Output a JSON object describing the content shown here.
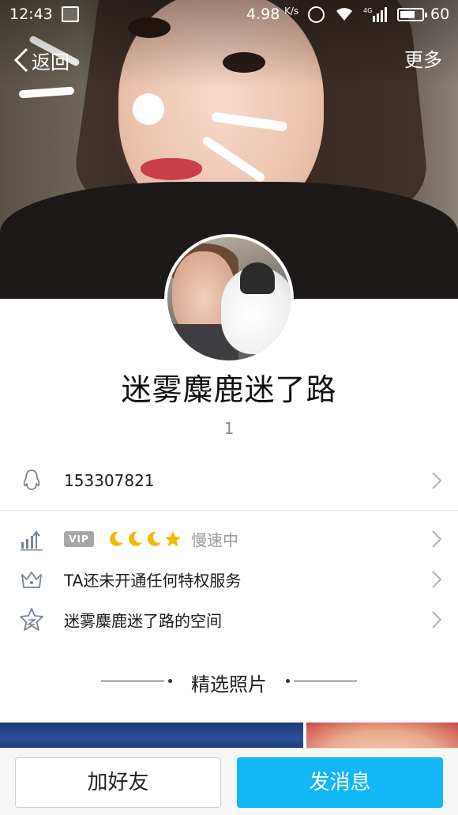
{
  "status_bar": {
    "time": "12:43",
    "network_speed": "4.98",
    "speed_unit": "K/s",
    "network_type": "4G",
    "battery": "60"
  },
  "nav": {
    "back_label": "返回",
    "more_label": "更多"
  },
  "profile": {
    "nickname": "迷雾麋鹿迷了路",
    "signature": "1",
    "qq_number": "153307821"
  },
  "level": {
    "vip_badge": "VIP",
    "icons": [
      "moon-icon",
      "moon-icon",
      "moon-icon",
      "star-icon"
    ],
    "status": "慢速中"
  },
  "privilege": {
    "text": "TA还未开通任何特权服务"
  },
  "space": {
    "text": "迷雾麋鹿迷了路的空间"
  },
  "photos": {
    "title": "精选照片"
  },
  "actions": {
    "add_friend": "加好友",
    "send_message": "发消息"
  },
  "colors": {
    "primary_button": "#12b7f5",
    "icon_gray": "#7a8494",
    "moon_gold": "#f5b800"
  }
}
